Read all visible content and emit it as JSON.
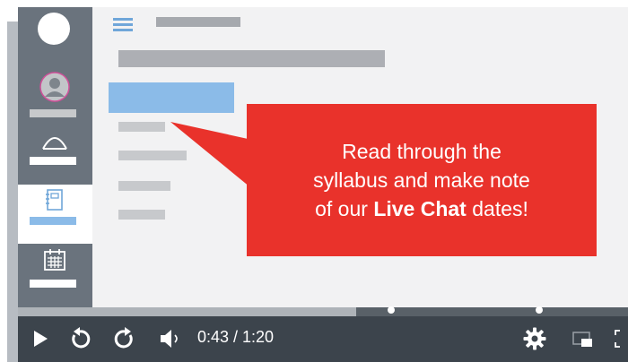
{
  "callout": {
    "line1": "Read through the",
    "line2": "syllabus and make note",
    "line3_pre": "of our ",
    "line3_bold": "Live Chat",
    "line3_post": " dates!"
  },
  "player": {
    "time": "0:43 / 1:20",
    "progress_fraction": 0.555
  },
  "colors": {
    "callout": "#e9322b",
    "accent_blue": "#8bbbe8",
    "sidebar": "#6a737d",
    "controls": "#3c444c"
  },
  "icons": [
    "menu-icon",
    "avatar-icon",
    "dome-icon",
    "notebook-icon",
    "calendar-icon",
    "play-icon",
    "rewind-icon",
    "forward-icon",
    "volume-icon",
    "gear-icon",
    "pip-icon",
    "fullscreen-icon"
  ]
}
